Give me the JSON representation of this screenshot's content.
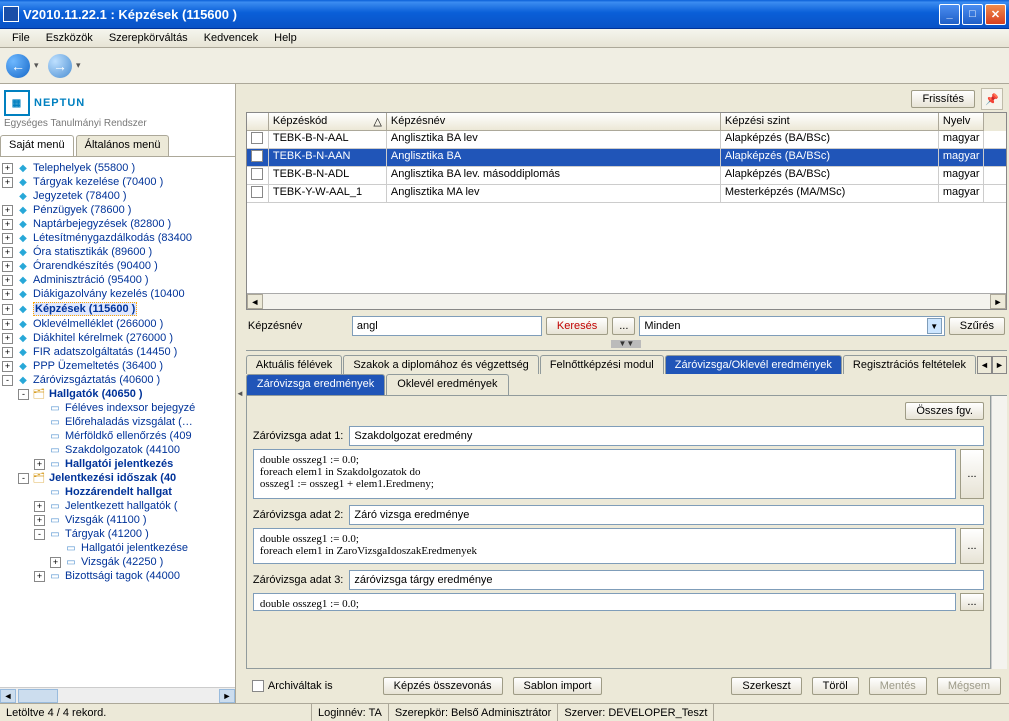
{
  "window": {
    "title": "V2010.11.22.1 : Képzések (115600  )"
  },
  "menu": {
    "file": "File",
    "tools": "Eszközök",
    "roles": "Szerepkörváltás",
    "fav": "Kedvencek",
    "help": "Help"
  },
  "logo": {
    "name": "NEPTUN",
    "sub": "Egységes Tanulmányi Rendszer"
  },
  "leftTabs": {
    "own": "Saját menü",
    "general": "Általános menü"
  },
  "tree": [
    {
      "exp": "+",
      "icon": "diamond",
      "label": "Telephelyek (55800  )",
      "indent": 0
    },
    {
      "exp": "+",
      "icon": "diamond",
      "label": "Tárgyak kezelése (70400  )",
      "indent": 0
    },
    {
      "exp": "",
      "icon": "diamond",
      "label": "Jegyzetek (78400  )",
      "indent": 0
    },
    {
      "exp": "+",
      "icon": "diamond",
      "label": "Pénzügyek (78600  )",
      "indent": 0
    },
    {
      "exp": "+",
      "icon": "diamond",
      "label": "Naptárbejegyzések (82800  )",
      "indent": 0
    },
    {
      "exp": "+",
      "icon": "diamond",
      "label": "Létesítménygazdálkodás (83400",
      "indent": 0
    },
    {
      "exp": "+",
      "icon": "diamond",
      "label": "Óra statisztikák (89600  )",
      "indent": 0
    },
    {
      "exp": "+",
      "icon": "diamond",
      "label": "Órarendkészítés (90400  )",
      "indent": 0
    },
    {
      "exp": "+",
      "icon": "diamond",
      "label": "Adminisztráció (95400  )",
      "indent": 0
    },
    {
      "exp": "+",
      "icon": "diamond",
      "label": "Diákigazolvány kezelés (10400",
      "indent": 0
    },
    {
      "exp": "+",
      "icon": "diamond",
      "label": "Képzések (115600  )",
      "indent": 0,
      "selected": true,
      "bold": true
    },
    {
      "exp": "+",
      "icon": "diamond",
      "label": "Oklevélmelléklet (266000  )",
      "indent": 0
    },
    {
      "exp": "+",
      "icon": "diamond",
      "label": "Diákhitel kérelmek (276000  )",
      "indent": 0
    },
    {
      "exp": "+",
      "icon": "diamond",
      "label": "FIR adatszolgáltatás (14450  )",
      "indent": 0
    },
    {
      "exp": "+",
      "icon": "diamond",
      "label": "PPP Üzemeltetés (36400  )",
      "indent": 0
    },
    {
      "exp": "-",
      "icon": "diamond",
      "label": "Záróvizsgáztatás (40600  )",
      "indent": 0
    },
    {
      "exp": "-",
      "icon": "folder",
      "label": "Hallgatók (40650  )",
      "indent": 1,
      "bold": true
    },
    {
      "exp": "",
      "icon": "card",
      "label": "Féléves indexsor bejegyzé",
      "indent": 2
    },
    {
      "exp": "",
      "icon": "card",
      "label": "Előrehaladás vizsgálat (…",
      "indent": 2
    },
    {
      "exp": "",
      "icon": "card",
      "label": "Mérföldkő ellenőrzés (409",
      "indent": 2
    },
    {
      "exp": "",
      "icon": "card",
      "label": "Szakdolgozatok (44100",
      "indent": 2
    },
    {
      "exp": "+",
      "icon": "card",
      "label": "Hallgatói jelentkezés",
      "indent": 2,
      "bold": true
    },
    {
      "exp": "-",
      "icon": "folder",
      "label": "Jelentkezési időszak (40",
      "indent": 1,
      "bold": true
    },
    {
      "exp": "",
      "icon": "card",
      "label": "Hozzárendelt hallgat",
      "indent": 2,
      "bold": true
    },
    {
      "exp": "+",
      "icon": "card",
      "label": "Jelentkezett hallgatók (",
      "indent": 2
    },
    {
      "exp": "+",
      "icon": "card",
      "label": "Vizsgák (41100  )",
      "indent": 2
    },
    {
      "exp": "-",
      "icon": "card",
      "label": "Tárgyak (41200  )",
      "indent": 2
    },
    {
      "exp": "",
      "icon": "card",
      "label": "Hallgatói jelentkezése",
      "indent": 3
    },
    {
      "exp": "+",
      "icon": "card",
      "label": "Vizsgák (42250  )",
      "indent": 3
    },
    {
      "exp": "+",
      "icon": "card",
      "label": "Bizottsági tagok (44000",
      "indent": 2
    }
  ],
  "refresh": "Frissítés",
  "gridHeaders": {
    "code": "Képzéskód",
    "name": "Képzésnév",
    "level": "Képzési szint",
    "lang": "Nyelv"
  },
  "gridRows": [
    {
      "code": "TEBK-B-N-AAL",
      "name": "Anglisztika BA lev",
      "level": "Alapképzés (BA/BSc)",
      "lang": "magyar"
    },
    {
      "code": "TEBK-B-N-AAN",
      "name": "Anglisztika BA",
      "level": "Alapképzés (BA/BSc)",
      "lang": "magyar",
      "sel": true
    },
    {
      "code": "TEBK-B-N-ADL",
      "name": "Anglisztika BA lev. másoddiplomás",
      "level": "Alapképzés (BA/BSc)",
      "lang": "magyar"
    },
    {
      "code": "TEBK-Y-W-AAL_1",
      "name": "Anglisztika MA lev",
      "level": "Mesterképzés (MA/MSc)",
      "lang": "magyar"
    }
  ],
  "search": {
    "label": "Képzésnév",
    "value": "angl",
    "keres": "Keresés",
    "dots": "...",
    "minden": "Minden",
    "szures": "Szűrés"
  },
  "modTabs": [
    "Aktuális félévek",
    "Szakok a diplomához és végzettség",
    "Felnőttképzési modul",
    "Záróvizsga/Oklevél eredmények",
    "Regisztrációs feltételek"
  ],
  "modActive": 3,
  "subTabs": [
    "Záróvizsga eredmények",
    "Oklevél eredmények"
  ],
  "subActive": 0,
  "osszes": "Összes fgv.",
  "adat": [
    {
      "label": "Záróvizsga adat 1:",
      "field": "Szakdolgozat eredmény",
      "code": "double osszeg1 := 0.0;\nforeach elem1 in Szakdolgozatok do\nosszeg1 := osszeg1 + elem1.Eredmeny;"
    },
    {
      "label": "Záróvizsga adat 2:",
      "field": "Záró vizsga eredménye",
      "code": "double osszeg1 := 0.0;\nforeach elem1 in ZaroVizsgaIdoszakEredmenyek"
    },
    {
      "label": "Záróvizsga adat 3:",
      "field": "záróvizsga tárgy eredménye",
      "code": "double osszeg1 := 0.0;"
    }
  ],
  "bottom": {
    "archive": "Archiváltak is",
    "merge": "Képzés összevonás",
    "import": "Sablon import",
    "edit": "Szerkeszt",
    "delete": "Töröl",
    "save": "Mentés",
    "cancel": "Mégsem"
  },
  "status": {
    "records": "Letöltve 4 / 4 rekord.",
    "login": "Loginnév: TA",
    "role": "Szerepkör: Belső Adminisztrátor",
    "server": "Szerver: DEVELOPER_Teszt"
  }
}
